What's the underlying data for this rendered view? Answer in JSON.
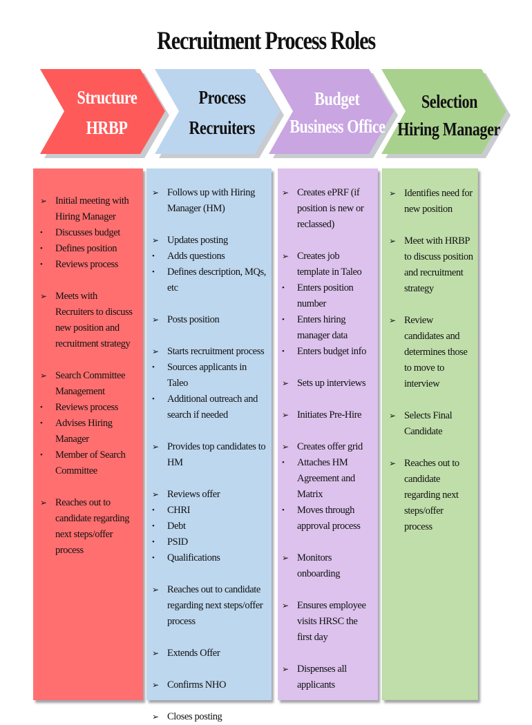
{
  "title": "Recruitment Process Roles",
  "colors": {
    "structure": "#fe5a5a",
    "process": "#bcd5ef",
    "budget": "#c9a5e2",
    "selection": "#a9d18e",
    "structure_panel": "#ff6f6f",
    "process_panel": "#bdd7ee",
    "budget_panel": "#dcc2ec",
    "selection_panel": "#c0deaa"
  },
  "stages": [
    {
      "key": "structure",
      "line1": "Structure",
      "line2": "HRBP",
      "items": [
        {
          "type": "arrow",
          "text": "Initial meeting with Hiring Manager"
        },
        {
          "type": "bullet",
          "text": "Discusses budget"
        },
        {
          "type": "bullet",
          "text": "Defines position"
        },
        {
          "type": "bullet",
          "text": "Reviews process"
        },
        {
          "type": "gap"
        },
        {
          "type": "arrow",
          "text": "Meets with Recruiters to discuss new position and recruitment strategy"
        },
        {
          "type": "gap"
        },
        {
          "type": "arrow",
          "text": "Search Committee Management"
        },
        {
          "type": "bullet",
          "text": "Reviews process"
        },
        {
          "type": "bullet",
          "text": "Advises Hiring Manager"
        },
        {
          "type": "bullet",
          "text": "Member of Search Committee"
        },
        {
          "type": "gap"
        },
        {
          "type": "arrow",
          "text": "Reaches out to candidate regarding next steps/offer process"
        }
      ]
    },
    {
      "key": "process",
      "line1": "Process",
      "line2": "Recruiters",
      "items": [
        {
          "type": "arrow",
          "text": "Follows up with Hiring Manager (HM)"
        },
        {
          "type": "gap"
        },
        {
          "type": "arrow",
          "text": "Updates posting"
        },
        {
          "type": "bullet",
          "text": "Adds questions"
        },
        {
          "type": "bullet",
          "text": "Defines description, MQs, etc"
        },
        {
          "type": "gap"
        },
        {
          "type": "arrow",
          "text": "Posts position"
        },
        {
          "type": "gap"
        },
        {
          "type": "arrow",
          "text": "Starts recruitment process"
        },
        {
          "type": "bullet",
          "text": "Sources applicants in Taleo"
        },
        {
          "type": "bullet",
          "text": "Additional outreach and search if needed"
        },
        {
          "type": "gap"
        },
        {
          "type": "arrow",
          "text": "Provides top candidates to HM"
        },
        {
          "type": "gap"
        },
        {
          "type": "arrow",
          "text": "Reviews offer"
        },
        {
          "type": "bullet",
          "text": "CHRI"
        },
        {
          "type": "bullet",
          "text": "Debt"
        },
        {
          "type": "bullet",
          "text": "PSID"
        },
        {
          "type": "bullet",
          "text": "Qualifications"
        },
        {
          "type": "gap"
        },
        {
          "type": "arrow",
          "text": "Reaches out to candidate regarding next steps/offer process"
        },
        {
          "type": "gap"
        },
        {
          "type": "arrow",
          "text": "Extends Offer"
        },
        {
          "type": "gap"
        },
        {
          "type": "arrow",
          "text": "Confirms NHO"
        },
        {
          "type": "gap"
        },
        {
          "type": "arrow",
          "text": "Closes posting"
        }
      ]
    },
    {
      "key": "budget",
      "line1": "Budget",
      "line2": "Business Office",
      "items": [
        {
          "type": "arrow",
          "text": "Creates ePRF (if position is new or reclassed)"
        },
        {
          "type": "gap"
        },
        {
          "type": "arrow",
          "text": "Creates job template in Taleo"
        },
        {
          "type": "bullet",
          "text": "Enters position number"
        },
        {
          "type": "bullet",
          "text": "Enters hiring manager data"
        },
        {
          "type": "bullet",
          "text": "Enters budget info"
        },
        {
          "type": "gap"
        },
        {
          "type": "arrow",
          "text": "Sets up interviews"
        },
        {
          "type": "gap"
        },
        {
          "type": "arrow",
          "text": "Initiates Pre-Hire"
        },
        {
          "type": "gap"
        },
        {
          "type": "arrow",
          "text": "Creates offer grid"
        },
        {
          "type": "bullet",
          "text": "Attaches HM Agreement and Matrix"
        },
        {
          "type": "bullet",
          "text": "Moves through approval process"
        },
        {
          "type": "gap"
        },
        {
          "type": "arrow",
          "text": "Monitors onboarding"
        },
        {
          "type": "gap"
        },
        {
          "type": "arrow",
          "text": "Ensures employee visits HRSC the first day"
        },
        {
          "type": "gap"
        },
        {
          "type": "arrow",
          "text": "Dispenses all applicants"
        }
      ]
    },
    {
      "key": "selection",
      "line1": "Selection",
      "line2": "Hiring Manager",
      "items": [
        {
          "type": "arrow",
          "text": "Identifies need for new position"
        },
        {
          "type": "gap"
        },
        {
          "type": "arrow",
          "text": "Meet with HRBP to discuss position and recruitment strategy"
        },
        {
          "type": "gap"
        },
        {
          "type": "arrow",
          "text": "Review candidates and determines those to move to interview"
        },
        {
          "type": "gap"
        },
        {
          "type": "arrow",
          "text": "Selects Final Candidate"
        },
        {
          "type": "gap"
        },
        {
          "type": "arrow",
          "text": "Reaches out to candidate regarding next steps/offer process"
        }
      ]
    }
  ]
}
